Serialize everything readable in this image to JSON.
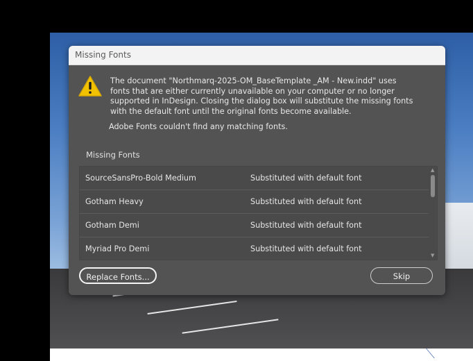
{
  "dialog": {
    "title": "Missing Fonts",
    "message": "The document \"Northmarq-2025-OM_BaseTemplate _AM - New.indd\" uses fonts that are either currently unavailable on your computer or no longer supported in InDesign. Closing the dialog box will substitute the missing fonts with the default font until the original fonts become available.",
    "adobe_fonts_message": "Adobe Fonts couldn't find any matching fonts.",
    "list_label": "Missing Fonts",
    "fonts": [
      {
        "name": "SourceSansPro-Bold Medium",
        "status": "Substituted with default font"
      },
      {
        "name": "Gotham Heavy",
        "status": "Substituted with default font"
      },
      {
        "name": "Gotham Demi",
        "status": "Substituted with default font"
      },
      {
        "name": "Myriad Pro Demi",
        "status": "Substituted with default font"
      }
    ],
    "replace_button": "Replace Fonts...",
    "skip_button": "Skip"
  },
  "icons": {
    "warning": "warning-icon",
    "scroll_up": "chevron-up-icon",
    "scroll_down": "chevron-down-icon"
  },
  "colors": {
    "dialog_bg": "#535353",
    "warning_yellow": "#f2c200"
  }
}
